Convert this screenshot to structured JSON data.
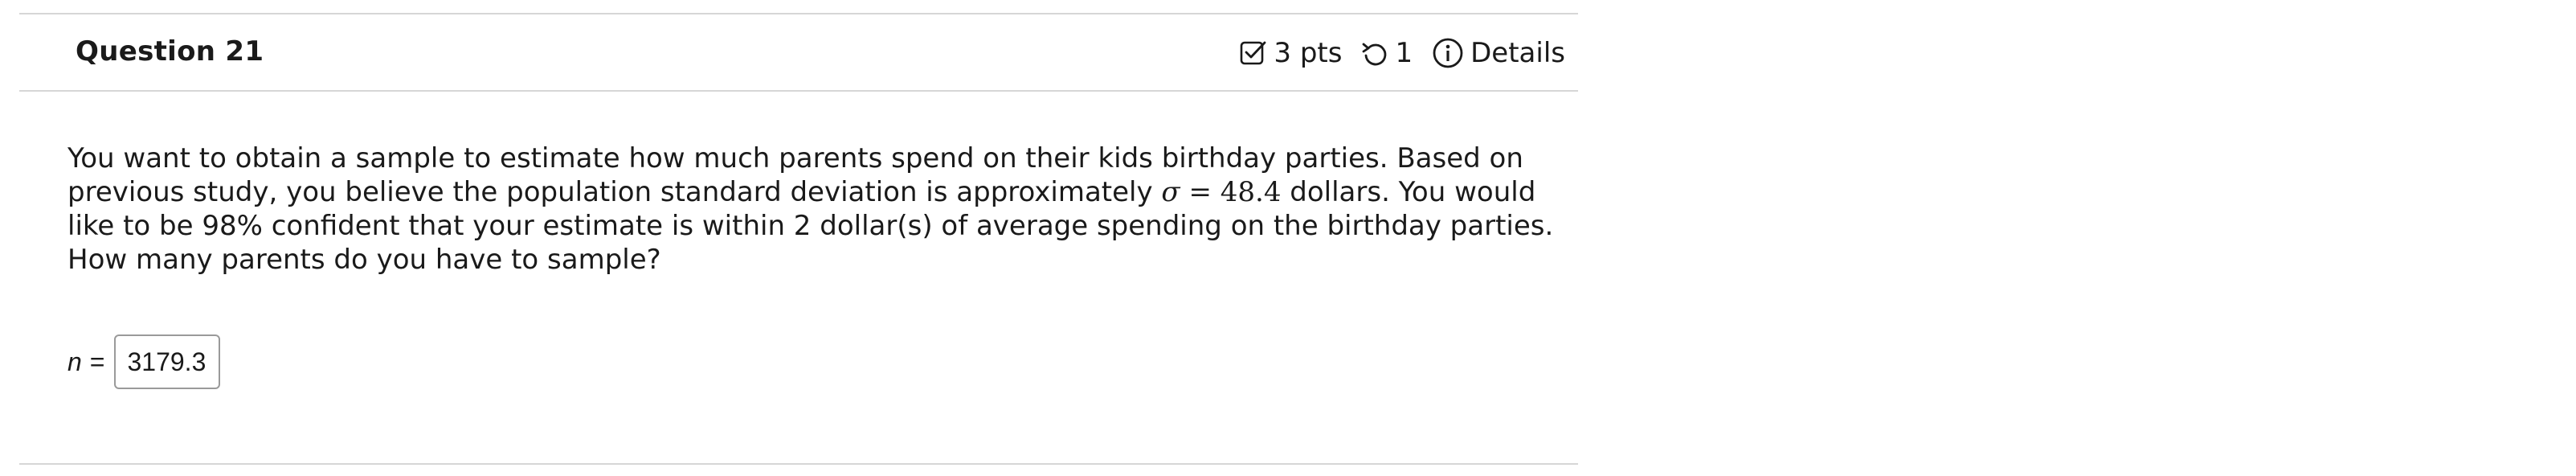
{
  "question": {
    "title": "Question 21",
    "points": "3 pts",
    "attempts": "1",
    "details_label": "Details"
  },
  "body": {
    "text_before_sigma": "You want to obtain a sample to estimate how much parents spend on their kids birthday parties. Based on previous study, you believe the population standard deviation is approximately ",
    "sigma_symbol": "σ",
    "sigma_equals": " = ",
    "sigma_value": "48.4",
    "text_after_sigma": " dollars. You would like to be 98% confident that your estimate is within 2 dollar(s) of average spending on the birthday parties. How many parents do you have to sample?"
  },
  "answer": {
    "variable": "n",
    "equals": "=",
    "value": "3179.3"
  },
  "icons": {
    "points": "checkbox-icon",
    "attempts": "retry-icon",
    "details": "info-icon"
  }
}
